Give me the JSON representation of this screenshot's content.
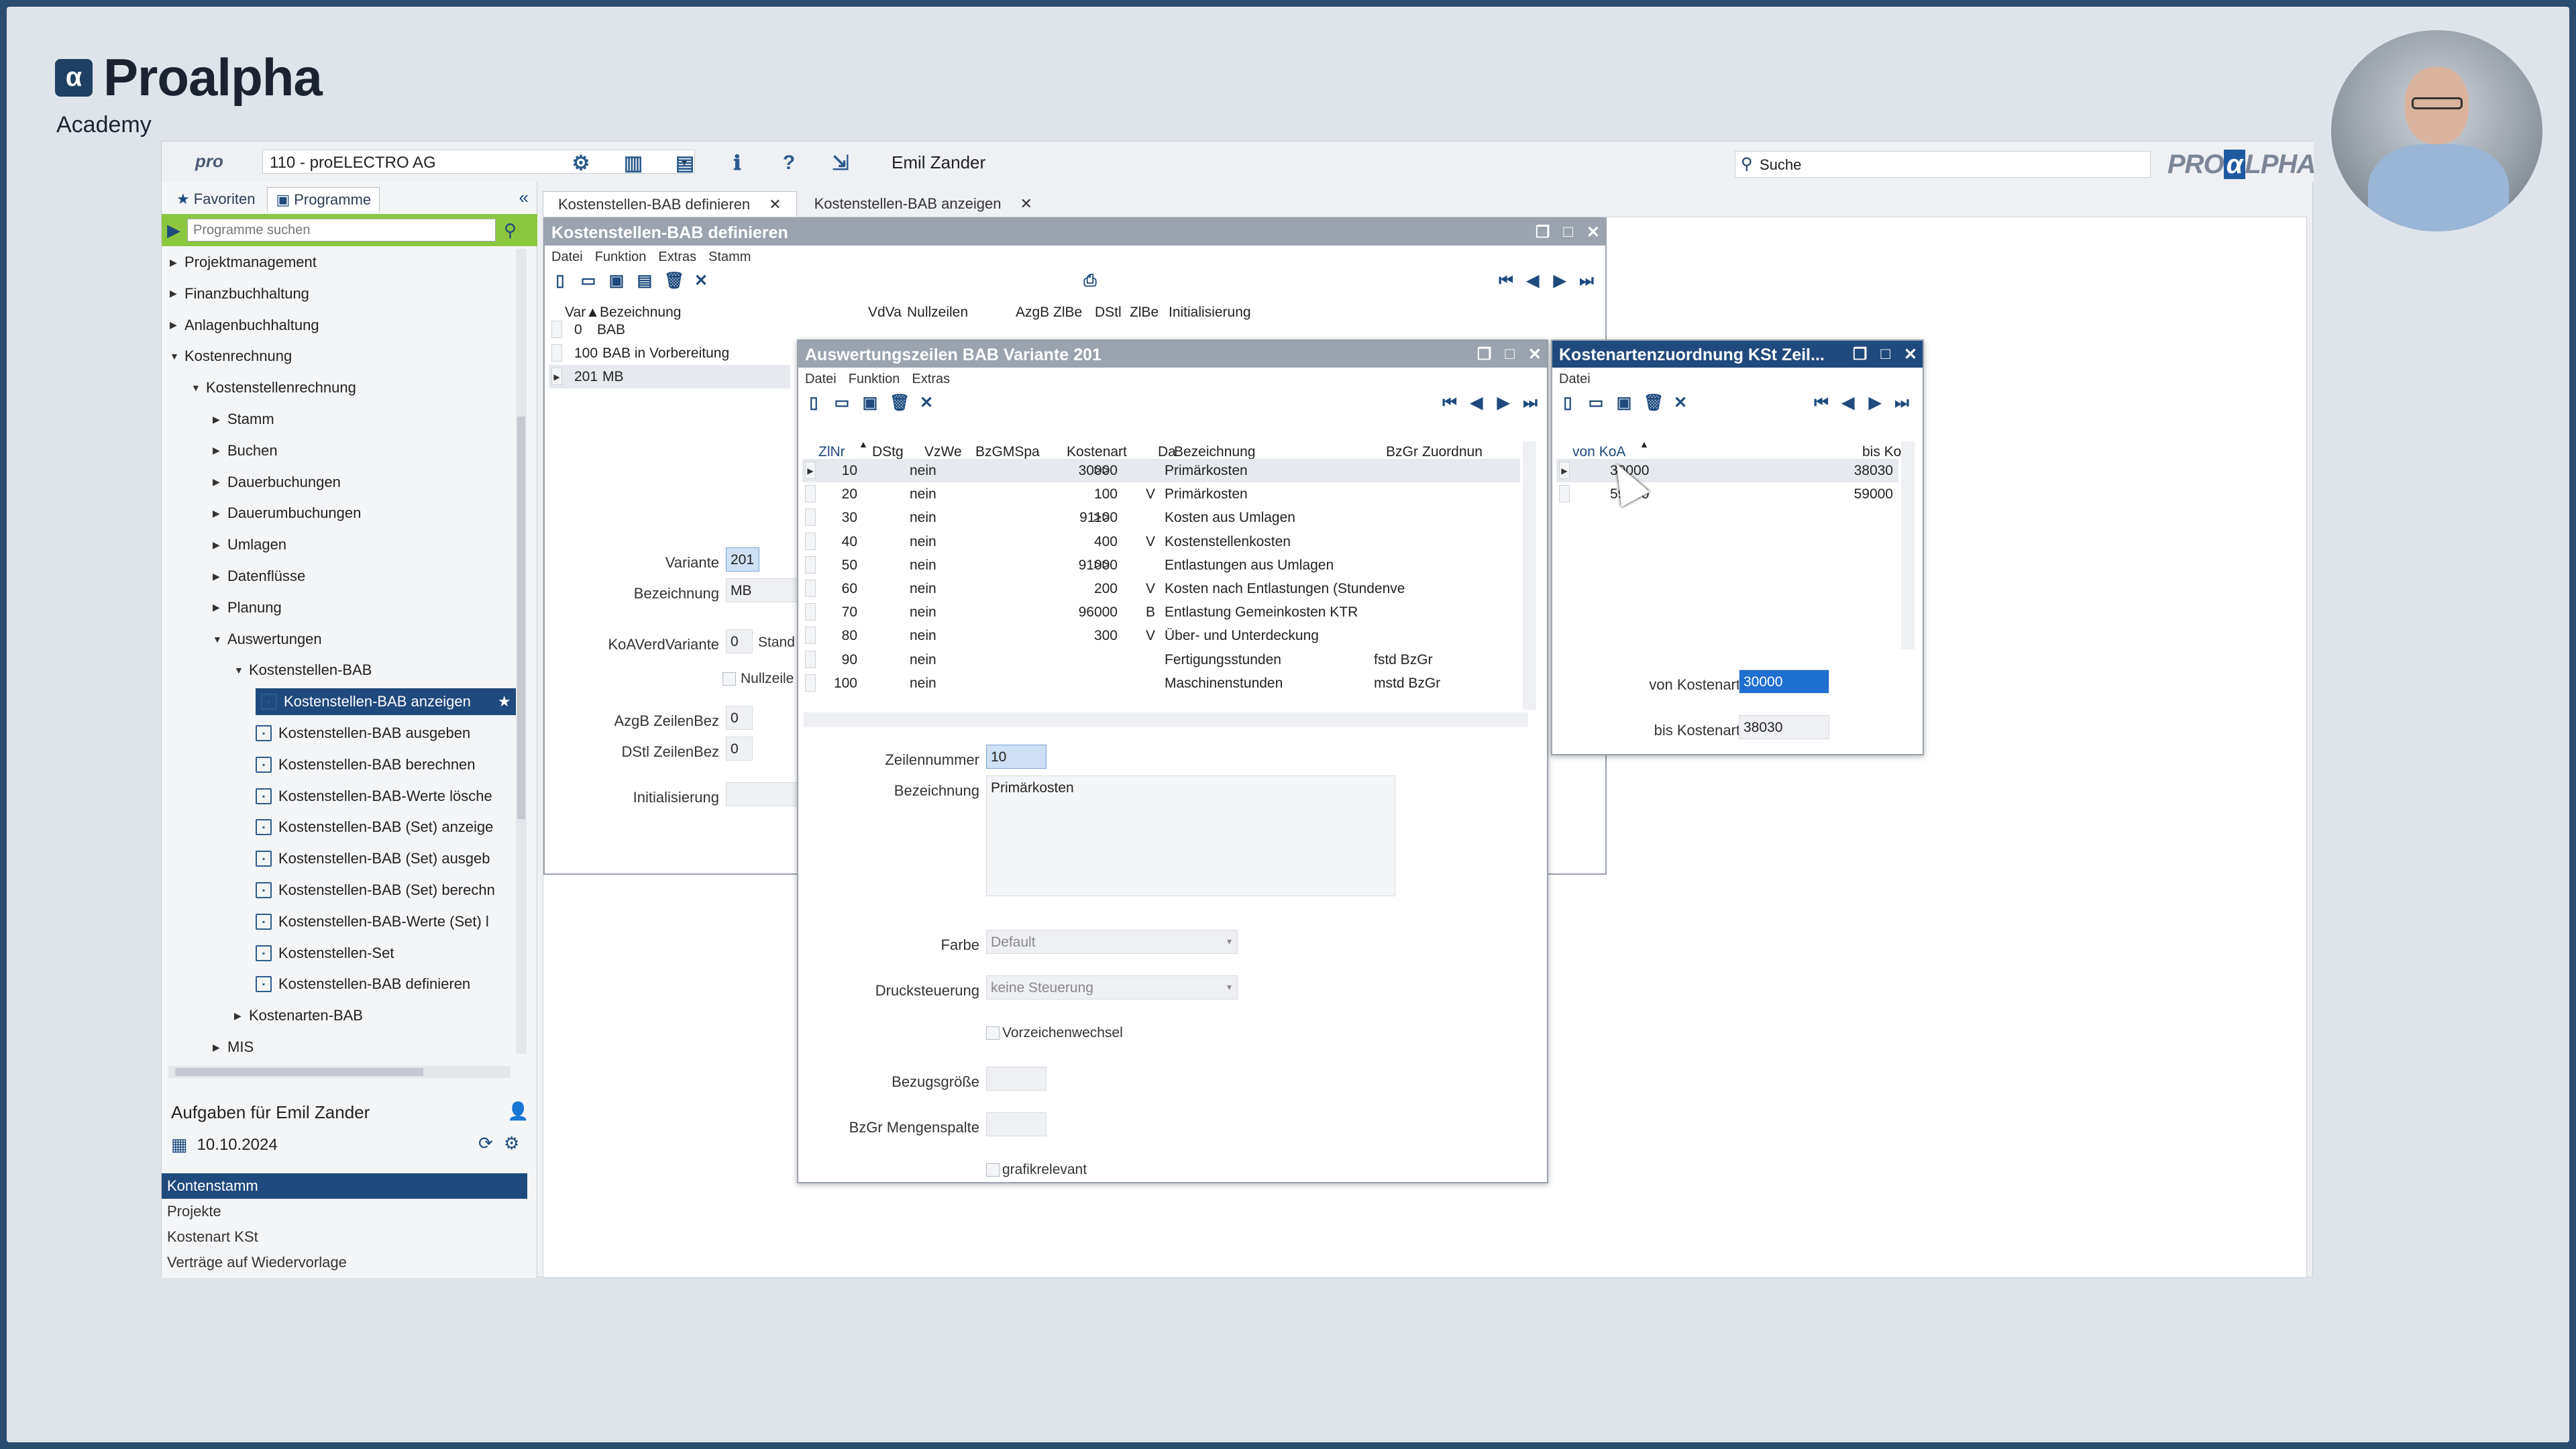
{
  "brand": {
    "name": "Proalpha",
    "sub": "Academy",
    "mark": "α"
  },
  "topbar": {
    "company": "110 - proELECTRO AG",
    "user": "Emil Zander",
    "search_placeholder": "Suche",
    "pro_logo": "pro",
    "pa_logo_a": "PRO",
    "pa_logo_b": "α",
    "pa_logo_c": "LPHA"
  },
  "left": {
    "tab_fav": "Favoriten",
    "tab_prog": "Programme",
    "search_placeholder": "Programme suchen",
    "tree": [
      {
        "label": "Projektmanagement",
        "level": 0,
        "tw": "▶"
      },
      {
        "label": "Finanzbuchhaltung",
        "level": 0,
        "tw": "▶"
      },
      {
        "label": "Anlagenbuchhaltung",
        "level": 0,
        "tw": "▶"
      },
      {
        "label": "Kostenrechnung",
        "level": 0,
        "tw": "▼"
      },
      {
        "label": "Kostenstellenrechnung",
        "level": 1,
        "tw": "▼"
      },
      {
        "label": "Stamm",
        "level": 2,
        "tw": "▶"
      },
      {
        "label": "Buchen",
        "level": 2,
        "tw": "▶"
      },
      {
        "label": "Dauerbuchungen",
        "level": 2,
        "tw": "▶"
      },
      {
        "label": "Dauerumbuchungen",
        "level": 2,
        "tw": "▶"
      },
      {
        "label": "Umlagen",
        "level": 2,
        "tw": "▶"
      },
      {
        "label": "Datenflüsse",
        "level": 2,
        "tw": "▶"
      },
      {
        "label": "Planung",
        "level": 2,
        "tw": "▶"
      },
      {
        "label": "Auswertungen",
        "level": 2,
        "tw": "▼"
      },
      {
        "label": "Kostenstellen-BAB",
        "level": 3,
        "tw": "▼"
      },
      {
        "label": "Kostenstellen-BAB anzeigen",
        "level": 4,
        "tw": "",
        "sel": true
      },
      {
        "label": "Kostenstellen-BAB ausgeben",
        "level": 4,
        "tw": ""
      },
      {
        "label": "Kostenstellen-BAB berechnen",
        "level": 4,
        "tw": ""
      },
      {
        "label": "Kostenstellen-BAB-Werte lösche",
        "level": 4,
        "tw": ""
      },
      {
        "label": "Kostenstellen-BAB (Set) anzeige",
        "level": 4,
        "tw": ""
      },
      {
        "label": "Kostenstellen-BAB (Set) ausgeb",
        "level": 4,
        "tw": ""
      },
      {
        "label": "Kostenstellen-BAB (Set) berechn",
        "level": 4,
        "tw": ""
      },
      {
        "label": "Kostenstellen-BAB-Werte (Set) l",
        "level": 4,
        "tw": ""
      },
      {
        "label": "Kostenstellen-Set",
        "level": 4,
        "tw": ""
      },
      {
        "label": "Kostenstellen-BAB definieren",
        "level": 4,
        "tw": ""
      },
      {
        "label": "Kostenarten-BAB",
        "level": 3,
        "tw": "▶"
      },
      {
        "label": "MIS",
        "level": 2,
        "tw": "▶"
      }
    ],
    "tasks_title": "Aufgaben für Emil Zander",
    "tasks_date": "10.10.2024",
    "tasks": [
      "Kontenstamm",
      "Projekte",
      "Kostenart KSt",
      "Verträge auf Wiedervorlage"
    ]
  },
  "doc_tabs": [
    "Kostenstellen-BAB definieren",
    "Kostenstellen-BAB anzeigen"
  ],
  "win1": {
    "title": "Kostenstellen-BAB definieren",
    "menu": [
      "Datei",
      "Funktion",
      "Extras",
      "Stamm"
    ],
    "cols": [
      "Var▲",
      "Bezeichnung",
      "VdVa",
      "Nullzeilen",
      "AzgB",
      "ZlBe",
      "DStl",
      "ZlBe",
      "Initialisierung"
    ],
    "rows": [
      {
        "var": "0",
        "bez": "BAB"
      },
      {
        "var": "100",
        "bez": "BAB in Vorbereitung"
      },
      {
        "var": "201",
        "bez": "MB"
      }
    ],
    "form": {
      "variante_label": "Variante",
      "variante": "201",
      "bez_label": "Bezeichnung",
      "bez": "MB",
      "koa_label": "KoAVerdVariante",
      "koa": "0",
      "koa_extra": "Stand",
      "null_label": "Nullzeile",
      "azgb_label": "AzgB ZeilenBez",
      "azgb": "0",
      "dstl_label": "DStl ZeilenBez",
      "dstl": "0",
      "init_label": "Initialisierung"
    }
  },
  "win2": {
    "title": "Auswertungszeilen BAB Variante 201",
    "menu": [
      "Datei",
      "Funktion",
      "Extras"
    ],
    "cols": [
      "ZlNr",
      "DStg",
      "VzWe",
      "BzGMSpa",
      "Kostenart",
      "Da",
      "Bezeichnung",
      "BzGr",
      "Zuordnun"
    ],
    "rows": [
      {
        "nr": "10",
        "vz": "nein",
        "koa": "30000",
        "ar": ">>",
        "da": "",
        "bez": "Primärkosten",
        "bzgr": ""
      },
      {
        "nr": "20",
        "vz": "nein",
        "koa": "100",
        "ar": "",
        "da": "V",
        "bez": "Primärkosten",
        "bzgr": ""
      },
      {
        "nr": "30",
        "vz": "nein",
        "koa": "91100",
        "ar": ">>",
        "da": "",
        "bez": "Kosten aus Umlagen",
        "bzgr": ""
      },
      {
        "nr": "40",
        "vz": "nein",
        "koa": "400",
        "ar": "",
        "da": "V",
        "bez": "Kostenstellenkosten",
        "bzgr": ""
      },
      {
        "nr": "50",
        "vz": "nein",
        "koa": "91000",
        "ar": ">>",
        "da": "",
        "bez": "Entlastungen aus Umlagen",
        "bzgr": ""
      },
      {
        "nr": "60",
        "vz": "nein",
        "koa": "200",
        "ar": "",
        "da": "V",
        "bez": "Kosten nach Entlastungen (Stundenve",
        "bzgr": ""
      },
      {
        "nr": "70",
        "vz": "nein",
        "koa": "96000",
        "ar": "",
        "da": "B",
        "bez": "Entlastung Gemeinkosten KTR",
        "bzgr": ""
      },
      {
        "nr": "80",
        "vz": "nein",
        "koa": "300",
        "ar": "",
        "da": "V",
        "bez": "Über- und Unterdeckung",
        "bzgr": ""
      },
      {
        "nr": "90",
        "vz": "nein",
        "koa": "",
        "ar": "",
        "da": "",
        "bez": "Fertigungsstunden",
        "bzgr": "fstd BzGr"
      },
      {
        "nr": "100",
        "vz": "nein",
        "koa": "",
        "ar": "",
        "da": "",
        "bez": "Maschinenstunden",
        "bzgr": "mstd BzGr"
      }
    ],
    "form": {
      "zeile_label": "Zeilennummer",
      "zeile": "10",
      "bez_label": "Bezeichnung",
      "bez": "Primärkosten",
      "farbe_label": "Farbe",
      "farbe": "Default",
      "druck_label": "Drucksteuerung",
      "druck": "keine Steuerung",
      "vorz_label": "Vorzeichenwechsel",
      "bezg_label": "Bezugsgröße",
      "bzgr_label": "BzGr Mengenspalte",
      "graf_label": "grafikrelevant"
    }
  },
  "win3": {
    "title": "Kostenartenzuordnung KSt Zeil...",
    "menu": [
      "Datei"
    ],
    "col_von": "von KoA",
    "col_bis": "bis KoA",
    "rows": [
      {
        "von": "30000",
        "bis": "38030"
      },
      {
        "von": "59000",
        "bis": "59000"
      }
    ],
    "von_label": "von Kostenart",
    "von": "30000",
    "bis_label": "bis Kostenart",
    "bis": "38030"
  },
  "colors": {
    "accent": "#1f4a7d",
    "green": "#8cc63f",
    "titlebar": "#9aa3ae"
  }
}
